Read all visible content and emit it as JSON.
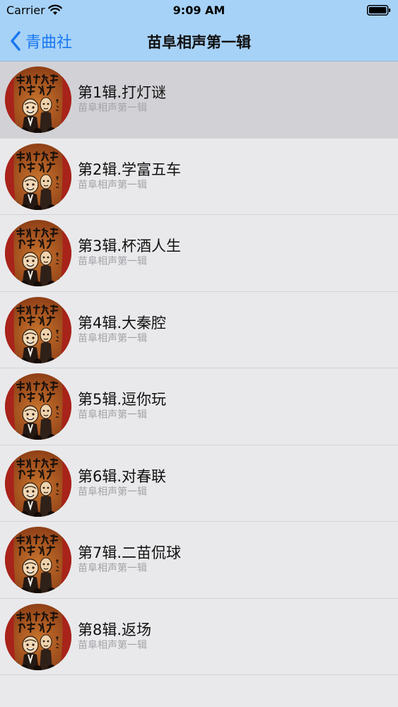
{
  "status_bar": {
    "carrier": "Carrier",
    "time": "9:09 AM",
    "icons": [
      "wifi-icon",
      "battery-icon"
    ]
  },
  "nav": {
    "back_label": "青曲社",
    "back_icon": "chevron-left-icon",
    "title": "苗阜相声第一辑",
    "accent_color": "#1a78f0",
    "bar_color": "#a7d2f7"
  },
  "list": {
    "selected_index": 0,
    "items": [
      {
        "title": "第1辑.打灯谜",
        "subtitle": "苗阜相声第一辑"
      },
      {
        "title": "第2辑.学富五车",
        "subtitle": "苗阜相声第一辑"
      },
      {
        "title": "第3辑.杯酒人生",
        "subtitle": "苗阜相声第一辑"
      },
      {
        "title": "第4辑.大秦腔",
        "subtitle": "苗阜相声第一辑"
      },
      {
        "title": "第5辑.逗你玩",
        "subtitle": "苗阜相声第一辑"
      },
      {
        "title": "第6辑.对春联",
        "subtitle": "苗阜相声第一辑"
      },
      {
        "title": "第7辑.二苗侃球",
        "subtitle": "苗阜相声第一辑"
      },
      {
        "title": "第8辑.返场",
        "subtitle": "苗阜相声第一辑"
      }
    ]
  }
}
